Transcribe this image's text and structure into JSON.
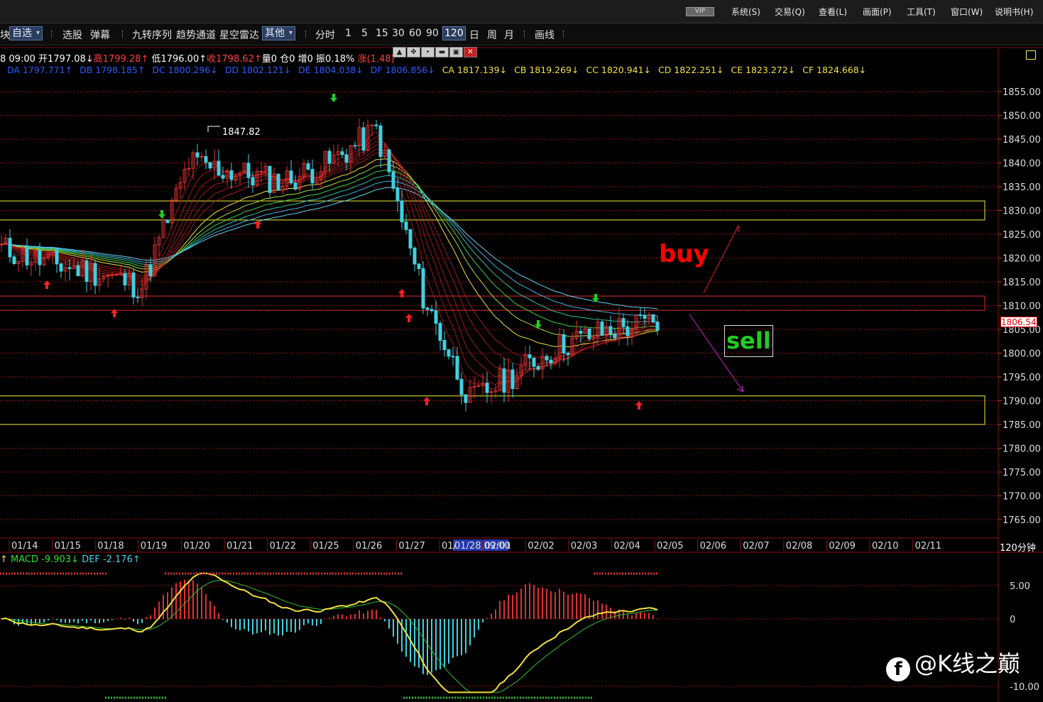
{
  "menu": [
    "系统(S)",
    "交易(Q)",
    "查看(L)",
    "画面(P)",
    "工具(T)",
    "窗口(W)",
    "说明书(H)"
  ],
  "vip_label": "VIP",
  "toolbar": {
    "block_char": "块",
    "watchlist": "自选",
    "stock_pick": "选股",
    "popup": "弹幕",
    "nine_turn": "九转序列",
    "trend_channel": "趋势通道",
    "star_radar": "星空雷达",
    "other": "其他",
    "intraday": "分时",
    "periods": [
      "1",
      "5",
      "15",
      "30",
      "60",
      "90",
      "120",
      "日",
      "周",
      "月"
    ],
    "active_period": "120",
    "draw": "画线"
  },
  "info": {
    "time": "8 09:00",
    "open": "开1797.08↓",
    "high": "高1799.28↑",
    "low": "低1796.00↑",
    "close": "收1798.62↑",
    "volume": "量0",
    "oi": "仓0",
    "oi_change": "增0",
    "amplitude": "振0.18%",
    "change": "涨(1.48)"
  },
  "ma_line": [
    {
      "text": "DA 1797.771↑",
      "color": "#2b5bff"
    },
    {
      "text": "DB 1798.185↑",
      "color": "#2b5bff"
    },
    {
      "text": "DC 1800.296↓",
      "color": "#2b5bff"
    },
    {
      "text": "DD 1802.121↓",
      "color": "#2b5bff"
    },
    {
      "text": "DE 1804.038↓",
      "color": "#2b5bff"
    },
    {
      "text": "DF 1806.856↓",
      "color": "#2b5bff"
    },
    {
      "text": "CA 1817.139↓",
      "color": "#f0e040"
    },
    {
      "text": "CB 1819.269↓",
      "color": "#f0e040"
    },
    {
      "text": "CC 1820.941↓",
      "color": "#f0e040"
    },
    {
      "text": "CD 1822.251↓",
      "color": "#f0e040"
    },
    {
      "text": "CE 1823.272↓",
      "color": "#f0e040"
    },
    {
      "text": "CF 1824.668↓",
      "color": "#f0e040"
    }
  ],
  "price_axis": {
    "ticks": [
      1855,
      1850,
      1845,
      1840,
      1835,
      1830,
      1825,
      1820,
      1815,
      1810,
      1805,
      1800,
      1795,
      1790,
      1785,
      1780,
      1775,
      1770,
      1765
    ],
    "current_price": "1806.54"
  },
  "dates": [
    "01/14",
    "01/15",
    "01/18",
    "01/19",
    "01/20",
    "01/21",
    "01/22",
    "01/25",
    "01/26",
    "01/27",
    "01/28",
    "02/01",
    "02/02",
    "02/03",
    "02/04",
    "02/05",
    "02/06",
    "02/07",
    "02/08",
    "02/09",
    "02/10",
    "02/11"
  ],
  "crosshair_date": "01/28,09:00",
  "period_label": "120分钟",
  "macd_info": {
    "arrow": "↑",
    "macd": "MACD -9.903↓",
    "def": "DEF -2.176↑"
  },
  "macd_axis": [
    "5.00",
    "0",
    "-10.00"
  ],
  "annotations": {
    "buy": "buy",
    "sell": "sell",
    "high_label": "1847.82"
  },
  "zones": [
    {
      "name": "resistance-zone-upper",
      "from": 1828,
      "to": 1832,
      "color": "#f0f040"
    },
    {
      "name": "pivot-zone",
      "from": 1809,
      "to": 1812,
      "color": "#e03030"
    },
    {
      "name": "support-zone-lower",
      "from": 1785,
      "to": 1791,
      "color": "#f0f040"
    }
  ],
  "watermark": "@K线之巅",
  "colors": {
    "up": "#e03030",
    "down": "#40d0e0",
    "grid": "#8a1010",
    "zone_yellow": "#f0f040",
    "buy": "#ff0000",
    "sell": "#22cc22"
  },
  "chart_data": {
    "type": "candlestick",
    "y_range": [
      1762,
      1858
    ],
    "anchors": [
      {
        "date": "01/14",
        "price": 1822
      },
      {
        "date": "01/15",
        "price": 1819
      },
      {
        "date": "01/18",
        "price": 1817
      },
      {
        "date": "01/19",
        "price": 1814
      },
      {
        "date": "01/20",
        "price": 1840
      },
      {
        "date": "01/21",
        "price": 1838
      },
      {
        "date": "01/22",
        "price": 1836
      },
      {
        "date": "01/25",
        "price": 1840
      },
      {
        "date": "01/26",
        "price": 1847
      },
      {
        "date": "01/27",
        "price": 1812
      },
      {
        "date": "01/28",
        "price": 1790
      },
      {
        "date": "02/01",
        "price": 1796
      },
      {
        "date": "02/02",
        "price": 1802
      },
      {
        "date": "02/03",
        "price": 1805
      },
      {
        "date": "02/04",
        "price": 1806.5
      }
    ],
    "macd_range": [
      -11,
      7
    ]
  }
}
